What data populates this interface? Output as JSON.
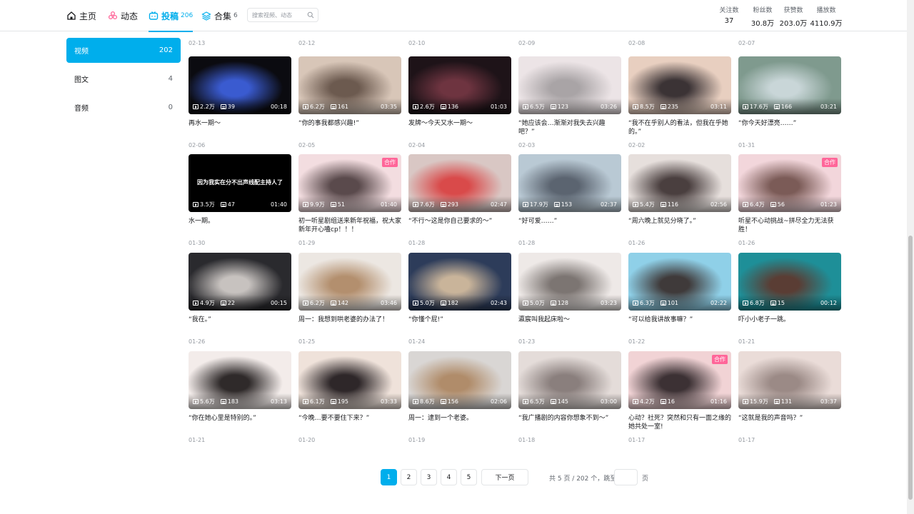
{
  "nav": {
    "home": "主页",
    "dynamic": "动态",
    "uploads": "投稿",
    "uploads_count": "206",
    "collections": "合集",
    "collections_count": "6",
    "search_placeholder": "搜索视频、动态"
  },
  "stats": [
    {
      "label": "关注数",
      "value": "37"
    },
    {
      "label": "粉丝数",
      "value": "30.8万"
    },
    {
      "label": "获赞数",
      "value": "203.0万"
    },
    {
      "label": "播放数",
      "value": "4110.9万"
    }
  ],
  "sidebar": [
    {
      "label": "视频",
      "count": "202"
    },
    {
      "label": "图文",
      "count": "4"
    },
    {
      "label": "音频",
      "count": "0"
    }
  ],
  "top_dates": [
    "02-13",
    "02-12",
    "02-10",
    "02-09",
    "02-08",
    "02-07"
  ],
  "videos": [
    {
      "plays": "2.2万",
      "danmaku": "39",
      "duration": "00:18",
      "title": "再水一期～",
      "date": "02-06",
      "bg": "#0b0b10",
      "accent": "#3a5bd0",
      "badge": "",
      "overlay": ""
    },
    {
      "plays": "6.2万",
      "danmaku": "161",
      "duration": "03:35",
      "title": "“你的事我都感兴趣!”",
      "date": "02-05",
      "bg": "#d8c6b8",
      "accent": "#6c5a4f",
      "badge": "",
      "overlay": ""
    },
    {
      "plays": "2.6万",
      "danmaku": "136",
      "duration": "01:03",
      "title": "发牌～今天又水一期～",
      "date": "02-04",
      "bg": "#1e1318",
      "accent": "#6e3440",
      "badge": "",
      "overlay": ""
    },
    {
      "plays": "6.5万",
      "danmaku": "123",
      "duration": "03:26",
      "title": "“她应该会…渐渐对我失去兴趣吧？”",
      "date": "02-03",
      "bg": "#ece4e6",
      "accent": "#a9a4a6",
      "badge": "",
      "overlay": ""
    },
    {
      "plays": "8.5万",
      "danmaku": "235",
      "duration": "03:11",
      "title": "“我不在乎别人的看法，但我在乎她的。”",
      "date": "02-02",
      "bg": "#e8cfc0",
      "accent": "#3b3335",
      "badge": "",
      "overlay": ""
    },
    {
      "plays": "17.6万",
      "danmaku": "166",
      "duration": "03:21",
      "title": "“你今天好漂亮……”",
      "date": "01-31",
      "bg": "#7f9a8e",
      "accent": "#c9d6d8",
      "badge": "",
      "overlay": ""
    },
    {
      "plays": "3.5万",
      "danmaku": "47",
      "duration": "01:40",
      "title": "水一期。",
      "date": "01-30",
      "bg": "#000000",
      "accent": "#000000",
      "badge": "",
      "overlay": "因为我实在分不出声线配主持人了"
    },
    {
      "plays": "9.9万",
      "danmaku": "51",
      "duration": "01:40",
      "title": "初一听星剧组送来新年祝福，祝大家新年开心嗑cp！！！",
      "date": "01-29",
      "bg": "#f3dde0",
      "accent": "#5a4a4c",
      "badge": "合作",
      "overlay": ""
    },
    {
      "plays": "7.6万",
      "danmaku": "293",
      "duration": "02:47",
      "title": "“不行～这是你自己要求的～”",
      "date": "01-28",
      "bg": "#d9c7c4",
      "accent": "#d94a4a",
      "badge": "",
      "overlay": ""
    },
    {
      "plays": "17.9万",
      "danmaku": "153",
      "duration": "02:37",
      "title": "“好可爱……”",
      "date": "01-28",
      "bg": "#b9c9d4",
      "accent": "#5b6470",
      "badge": "",
      "overlay": ""
    },
    {
      "plays": "5.4万",
      "danmaku": "116",
      "duration": "02:56",
      "title": "“周六晚上就见分晓了。”",
      "date": "01-26",
      "bg": "#e6dfdc",
      "accent": "#4a3f3f",
      "badge": "",
      "overlay": ""
    },
    {
      "plays": "6.4万",
      "danmaku": "56",
      "duration": "01:23",
      "title": "听星不心动挑战~拼尽全力无法获胜！",
      "date": "01-26",
      "bg": "#f2d6db",
      "accent": "#7b5b57",
      "badge": "合作",
      "overlay": ""
    },
    {
      "plays": "4.9万",
      "danmaku": "22",
      "duration": "00:15",
      "title": "“我在。”",
      "date": "01-26",
      "bg": "#2a2a2e",
      "accent": "#c7c2bf",
      "badge": "",
      "overlay": ""
    },
    {
      "plays": "6.2万",
      "danmaku": "142",
      "duration": "03:46",
      "title": "周一：我想到哄老婆的办法了！",
      "date": "01-25",
      "bg": "#ece7e2",
      "accent": "#b38f6e",
      "badge": "",
      "overlay": ""
    },
    {
      "plays": "5.0万",
      "danmaku": "182",
      "duration": "02:43",
      "title": "“你懂个屁!”",
      "date": "01-24",
      "bg": "#2d3c5a",
      "accent": "#c9b49a",
      "badge": "",
      "overlay": ""
    },
    {
      "plays": "5.0万",
      "danmaku": "128",
      "duration": "03:23",
      "title": "瀛宸叫我起床啦～",
      "date": "01-23",
      "bg": "#eee9e7",
      "accent": "#7c7572",
      "badge": "",
      "overlay": ""
    },
    {
      "plays": "6.3万",
      "danmaku": "101",
      "duration": "02:22",
      "title": "“可以给我讲故事嘛？”",
      "date": "01-22",
      "bg": "#8fd0e8",
      "accent": "#3f3a3a",
      "badge": "",
      "overlay": ""
    },
    {
      "plays": "6.8万",
      "danmaku": "15",
      "duration": "00:12",
      "title": "吓小小老子一跳。",
      "date": "01-21",
      "bg": "#1e8f98",
      "accent": "#5a3d34",
      "badge": "",
      "overlay": ""
    },
    {
      "plays": "5.6万",
      "danmaku": "183",
      "duration": "03:13",
      "title": "“你在她心里是特别的。”",
      "date": "01-21",
      "bg": "#f3ecea",
      "accent": "#2f2a2a",
      "badge": "",
      "overlay": ""
    },
    {
      "plays": "6.1万",
      "danmaku": "195",
      "duration": "03:33",
      "title": "“今晚…要不要住下来？”",
      "date": "01-20",
      "bg": "#efe2da",
      "accent": "#2e2729",
      "badge": "",
      "overlay": ""
    },
    {
      "plays": "8.6万",
      "danmaku": "156",
      "duration": "02:06",
      "title": "周一：逮到一个老婆。",
      "date": "01-19",
      "bg": "#d9d6d4",
      "accent": "#b08c6a",
      "badge": "",
      "overlay": ""
    },
    {
      "plays": "6.5万",
      "danmaku": "145",
      "duration": "03:00",
      "title": "“我广播剧的内容你想象不到～”",
      "date": "01-18",
      "bg": "#e4dcd9",
      "accent": "#8a7f7d",
      "badge": "",
      "overlay": ""
    },
    {
      "plays": "4.2万",
      "danmaku": "16",
      "duration": "01:16",
      "title": "心动？社死？突然和只有一面之缘的她共处一室!",
      "date": "01-17",
      "bg": "#f1d3d5",
      "accent": "#3c3134",
      "badge": "合作",
      "overlay": ""
    },
    {
      "plays": "15.9万",
      "danmaku": "131",
      "duration": "03:37",
      "title": "“这就是我的声音吗？”",
      "date": "01-17",
      "bg": "#eadcd8",
      "accent": "#9b8a86",
      "badge": "",
      "overlay": ""
    }
  ],
  "pagination": {
    "pages": [
      "1",
      "2",
      "3",
      "4",
      "5"
    ],
    "next": "下一页",
    "info": "共 5 页 / 202 个，跳至",
    "page_suffix": "页"
  },
  "colors": {
    "accent": "#00aeec",
    "badge": "#ff6699"
  }
}
